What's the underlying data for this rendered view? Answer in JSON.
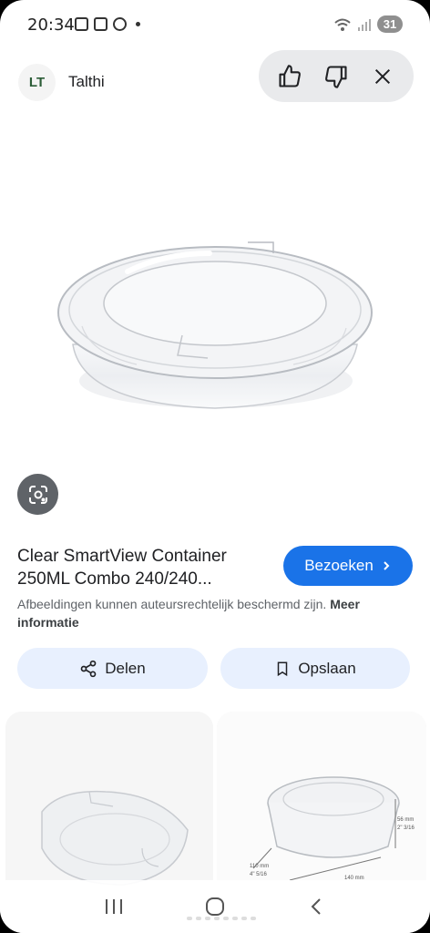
{
  "status_bar": {
    "time": "20:34",
    "battery": "31"
  },
  "header": {
    "site_logo_text": "LT",
    "site_name": "Talthi",
    "feedback": {
      "like_icon": "thumbs-up-icon",
      "dislike_icon": "thumbs-down-icon",
      "close_icon": "close-icon"
    }
  },
  "product": {
    "title": "Clear SmartView Container 250ML Combo 240/240...",
    "visit_label": "Bezoeken",
    "copyright_text": "Afbeeldingen kunnen auteursrechtelijk beschermd zijn.",
    "more_info_label": "Meer informatie",
    "share_label": "Delen",
    "save_label": "Opslaan"
  },
  "related_cards": {
    "dim_height": "56 mm",
    "dim_height_in": "2\" 3/16",
    "dim_depth": "110 mm",
    "dim_depth_in": "4\" 5/16",
    "dim_width": "140 mm"
  },
  "colors": {
    "accent": "#1a73e8",
    "action_bg": "#e8f0fe",
    "feedback_bg": "#e9eaec"
  }
}
